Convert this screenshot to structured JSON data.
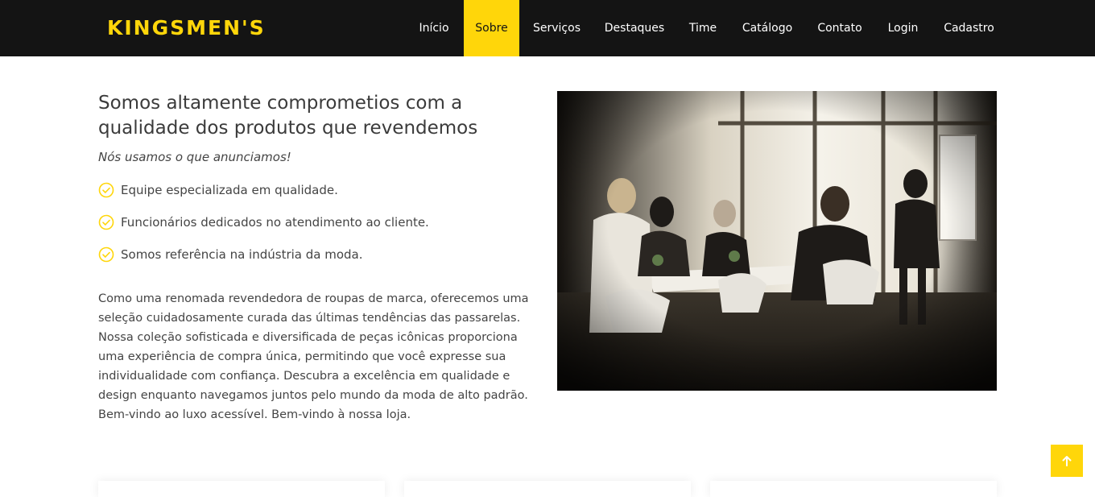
{
  "brand": {
    "logo": "KINGSMEN'S",
    "accent_color": "#ffd60a",
    "nav_bg": "#141414"
  },
  "nav": {
    "items": [
      {
        "label": "Início",
        "active": false
      },
      {
        "label": "Sobre",
        "active": true
      },
      {
        "label": "Serviços",
        "active": false
      },
      {
        "label": "Destaques",
        "active": false
      },
      {
        "label": "Time",
        "active": false
      },
      {
        "label": "Catálogo",
        "active": false
      },
      {
        "label": "Contato",
        "active": false
      },
      {
        "label": "Login",
        "active": false
      },
      {
        "label": "Cadastro",
        "active": false
      }
    ]
  },
  "about": {
    "title": "Somos altamente comprometios com a qualidade dos produtos que revendemos",
    "subtitle": "Nós usamos o que anunciamos!",
    "features": [
      {
        "icon": "check-circle-icon",
        "text": "Equipe especializada em qualidade."
      },
      {
        "icon": "check-circle-icon",
        "text": "Funcionários dedicados no atendimento ao cliente."
      },
      {
        "icon": "check-circle-icon",
        "text": "Somos referência na indústria da moda."
      }
    ],
    "paragraph": "Como uma renomada revendedora de roupas de marca, oferecemos uma seleção cuidadosamente curada das últimas tendências das passarelas. Nossa coleção sofisticada e diversificada de peças icônicas proporciona uma experiência de compra única, permitindo que você expresse sua individualidade com confiança. Descubra a excelência em qualidade e design enquanto navegamos juntos pelo mundo da moda de alto padrão. Bem-vindo ao luxo acessível. Bem-vindo à nossa loja."
  },
  "back_to_top": {
    "icon": "arrow-up-icon"
  }
}
